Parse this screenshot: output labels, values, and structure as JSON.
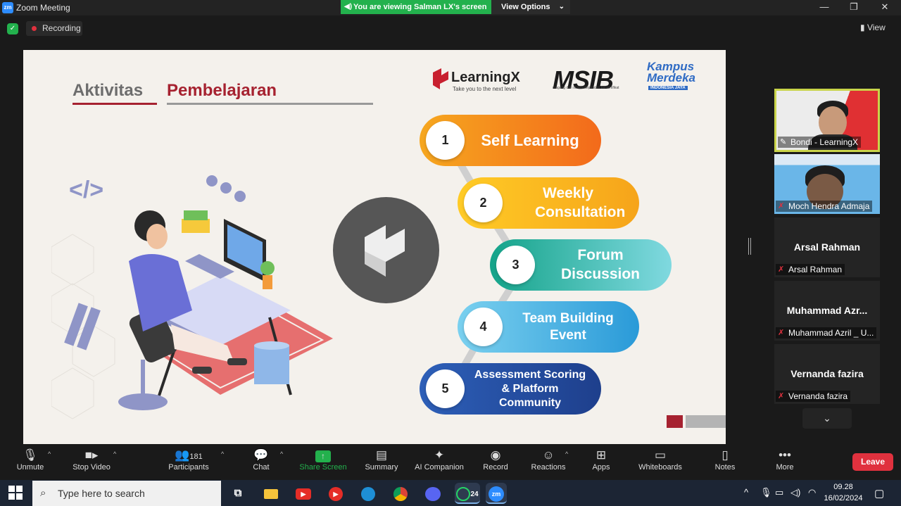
{
  "window": {
    "app_icon_text": "zm",
    "title": "Zoom Meeting",
    "viewing_banner": "You are viewing Salman LX's screen",
    "view_options": "View Options",
    "minimize": "—",
    "restore": "❐",
    "close": "✕"
  },
  "topbar": {
    "recording": "Recording",
    "view": "View"
  },
  "slide": {
    "heading_part1": "Aktivitas",
    "heading_part2": "Pembelajaran",
    "logos": {
      "learningx": "LearningX",
      "learningx_tagline": "Take you to the next level",
      "msib": "MSIB",
      "msib_tagline": "magang dan studi independen bersertifikat",
      "kampus_merdeka": "Kampus Merdeka",
      "kampus_merdeka_tagline": "INDONESIA JAYA"
    },
    "steps": [
      {
        "num": "1",
        "label": "Self Learning"
      },
      {
        "num": "2",
        "label": "Weekly Consultation"
      },
      {
        "num": "3",
        "label": "Forum Discussion"
      },
      {
        "num": "4",
        "label": "Team Building Event"
      },
      {
        "num": "5",
        "label": "Assessment Scoring & Platform Community"
      }
    ]
  },
  "participants": [
    {
      "label": "Bondi - LearningX",
      "mic": "pin"
    },
    {
      "label": "Moch Hendra Admaja",
      "mic": "muted"
    },
    {
      "name": "Arsal Rahman",
      "label": "Arsal Rahman",
      "mic": "muted"
    },
    {
      "name": "Muhammad  Azr...",
      "label": "Muhammad Azril _ U...",
      "mic": "muted"
    },
    {
      "name": "Vernanda fazira",
      "label": "Vernanda fazira",
      "mic": "muted"
    }
  ],
  "toolbar": {
    "unmute": "Unmute",
    "stop_video": "Stop Video",
    "participants": "Participants",
    "participants_count": "181",
    "chat": "Chat",
    "share_screen": "Share Screen",
    "summary": "Summary",
    "ai_companion": "AI Companion",
    "record": "Record",
    "reactions": "Reactions",
    "apps": "Apps",
    "whiteboards": "Whiteboards",
    "notes": "Notes",
    "more": "More",
    "leave": "Leave"
  },
  "taskbar": {
    "search_placeholder": "Type here to search",
    "whatsapp_badge": "24",
    "zoom_label": "zm",
    "time": "09.28",
    "date": "16/02/2024"
  },
  "colors": {
    "accent_red": "#a62230",
    "zoom_blue": "#2d8cff",
    "share_green": "#23b14d",
    "leave_red": "#e0313e"
  }
}
